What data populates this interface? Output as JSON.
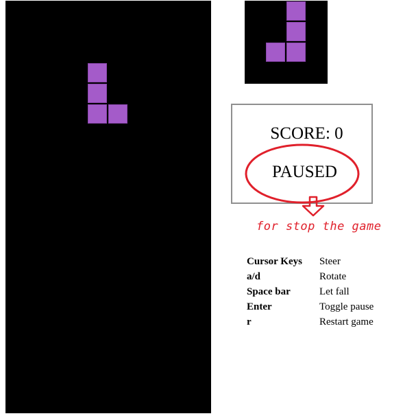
{
  "score": {
    "text": "SCORE: 0"
  },
  "status": {
    "text": "PAUSED"
  },
  "annotation": {
    "text": "for stop the game",
    "color": "#e0202b"
  },
  "piece_color": "#a45bc9",
  "board": {
    "columns": 10,
    "rows": 20,
    "active_piece": {
      "shape": "L",
      "cells": [
        [
          4,
          3
        ],
        [
          4,
          4
        ],
        [
          4,
          5
        ],
        [
          5,
          5
        ]
      ]
    }
  },
  "next_piece": {
    "shape": "J",
    "cells": [
      [
        2,
        0
      ],
      [
        2,
        1
      ],
      [
        1,
        2
      ],
      [
        2,
        2
      ]
    ]
  },
  "controls": [
    {
      "key": "Cursor Keys",
      "action": "Steer"
    },
    {
      "key": "a/d",
      "action": "Rotate"
    },
    {
      "key": "Space bar",
      "action": "Let fall"
    },
    {
      "key": "Enter",
      "action": "Toggle pause"
    },
    {
      "key": "r",
      "action": "Restart game"
    }
  ]
}
